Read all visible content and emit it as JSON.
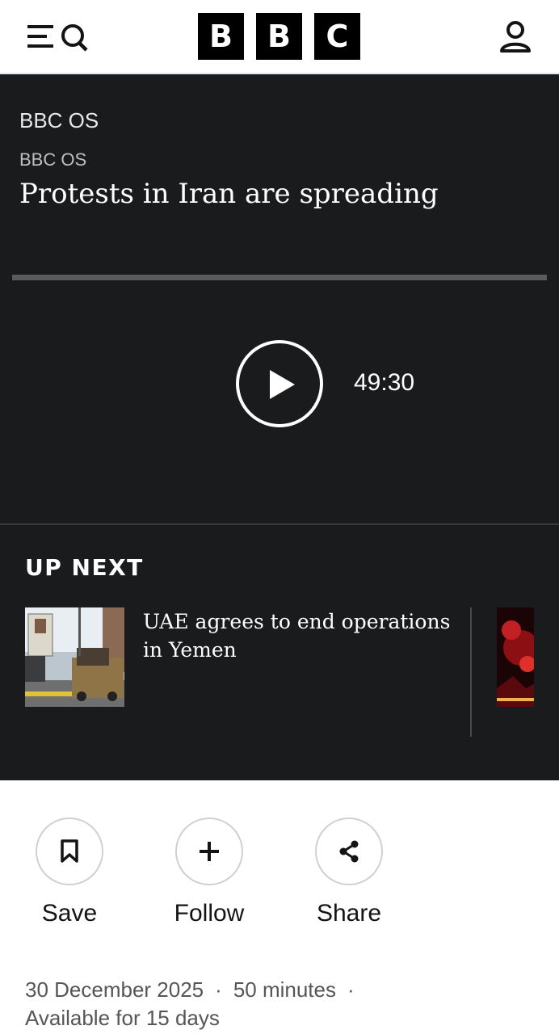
{
  "header": {
    "logo_letters": [
      "B",
      "B",
      "C"
    ],
    "menu_icon": "menu-search-icon",
    "account_icon": "account-icon"
  },
  "player": {
    "brand": "BBC OS",
    "subbrand": "BBC OS",
    "title": "Protests in Iran are spreading",
    "duration": "49:30",
    "progress": 0,
    "play_icon": "play-icon"
  },
  "upnext": {
    "heading": "UP NEXT",
    "items": [
      {
        "title": "UAE agrees to end operations in Yemen"
      }
    ]
  },
  "actions": {
    "save": {
      "label": "Save",
      "icon": "bookmark-icon"
    },
    "follow": {
      "label": "Follow",
      "icon": "plus-icon"
    },
    "share": {
      "label": "Share",
      "icon": "share-icon"
    }
  },
  "meta": {
    "date": "30 December 2025",
    "length": "50 minutes",
    "availability": "Available for 15 days"
  },
  "colors": {
    "player_bg": "#1a1b1d",
    "progress_track": "#5a5b5d",
    "meta_text": "#545658"
  }
}
